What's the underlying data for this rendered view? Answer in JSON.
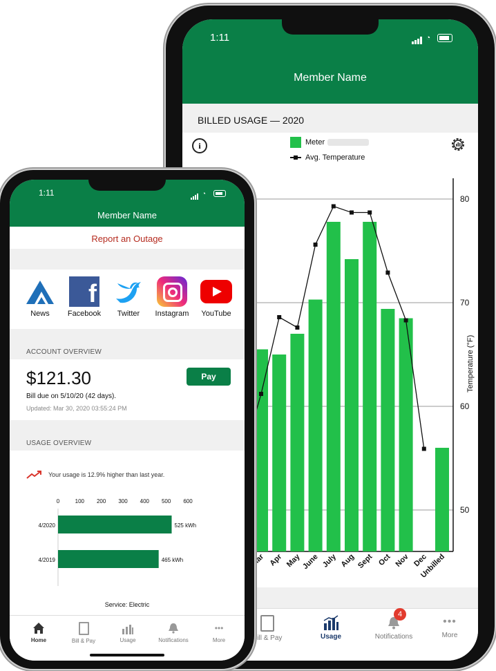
{
  "status_time": "1:11",
  "back_phone": {
    "header_title": "Member Name",
    "section_title": "BILLED USAGE — 2020",
    "info_icon": "info-icon",
    "settings_icon": "chart-settings-icon",
    "chart_data": {
      "type": "bar",
      "title": "",
      "categories": [
        "Mar",
        "Apr",
        "May",
        "June",
        "July",
        "Aug",
        "Sept",
        "Oct",
        "Nov",
        "Dec",
        "Unbilled"
      ],
      "series": [
        {
          "name": "Meter",
          "type": "bar",
          "color": "#22c04a",
          "values": [
            65.5,
            65.0,
            67.0,
            70.3,
            77.8,
            74.2,
            77.8,
            69.4,
            68.5,
            null,
            56.0
          ]
        },
        {
          "name": "Avg. Temperature",
          "type": "line",
          "color": "#111111",
          "values": [
            61.2,
            68.6,
            67.6,
            75.6,
            79.3,
            78.7,
            78.7,
            72.9,
            68.3,
            55.9,
            null
          ]
        }
      ],
      "y2label": "Temperature (°F)",
      "y2ticks": [
        "80",
        "70",
        "60",
        "50"
      ],
      "ylim": [
        46,
        82
      ],
      "grid": true,
      "legend": "top"
    },
    "tabs": [
      {
        "label": "Bill & Pay",
        "icon": "bill-icon"
      },
      {
        "label": "Usage",
        "icon": "usage-chart-icon"
      },
      {
        "label": "Notifications",
        "icon": "bell-icon",
        "badge": "4"
      },
      {
        "label": "More",
        "icon": "more-dots-icon"
      }
    ]
  },
  "front_phone": {
    "header_title": "Member Name",
    "report_outage": "Report an Outage",
    "social": [
      {
        "label": "News",
        "icon": "news-mountain-icon"
      },
      {
        "label": "Facebook",
        "icon": "facebook-icon"
      },
      {
        "label": "Twitter",
        "icon": "twitter-icon"
      },
      {
        "label": "Instagram",
        "icon": "instagram-icon"
      },
      {
        "label": "YouTube",
        "icon": "youtube-icon"
      }
    ],
    "account_overview_title": "ACCOUNT OVERVIEW",
    "amount": "$121.30",
    "bill_due": "Bill due on 5/10/20 (42 days).",
    "updated": "Updated: Mar 30, 2020 03:55:24 PM",
    "pay_label": "Pay",
    "usage_overview_title": "USAGE OVERVIEW",
    "usage_message": "Your usage is 12.9% higher than last year.",
    "usage_chart": {
      "type": "bar",
      "orientation": "horizontal",
      "xticks": [
        "0",
        "100",
        "200",
        "300",
        "400",
        "500",
        "600"
      ],
      "xlim": [
        0,
        600
      ],
      "categories": [
        "4/2020",
        "4/2019"
      ],
      "values": [
        525,
        465
      ],
      "value_labels": [
        "525 kWh",
        "465 kWh"
      ],
      "color": "#0a7f47"
    },
    "service": "Service: Electric",
    "tabs": [
      {
        "label": "Home",
        "icon": "home-icon"
      },
      {
        "label": "Bill & Pay",
        "icon": "bill-icon"
      },
      {
        "label": "Usage",
        "icon": "usage-chart-icon"
      },
      {
        "label": "Notifications",
        "icon": "bell-icon"
      },
      {
        "label": "More",
        "icon": "more-dots-icon"
      }
    ]
  }
}
